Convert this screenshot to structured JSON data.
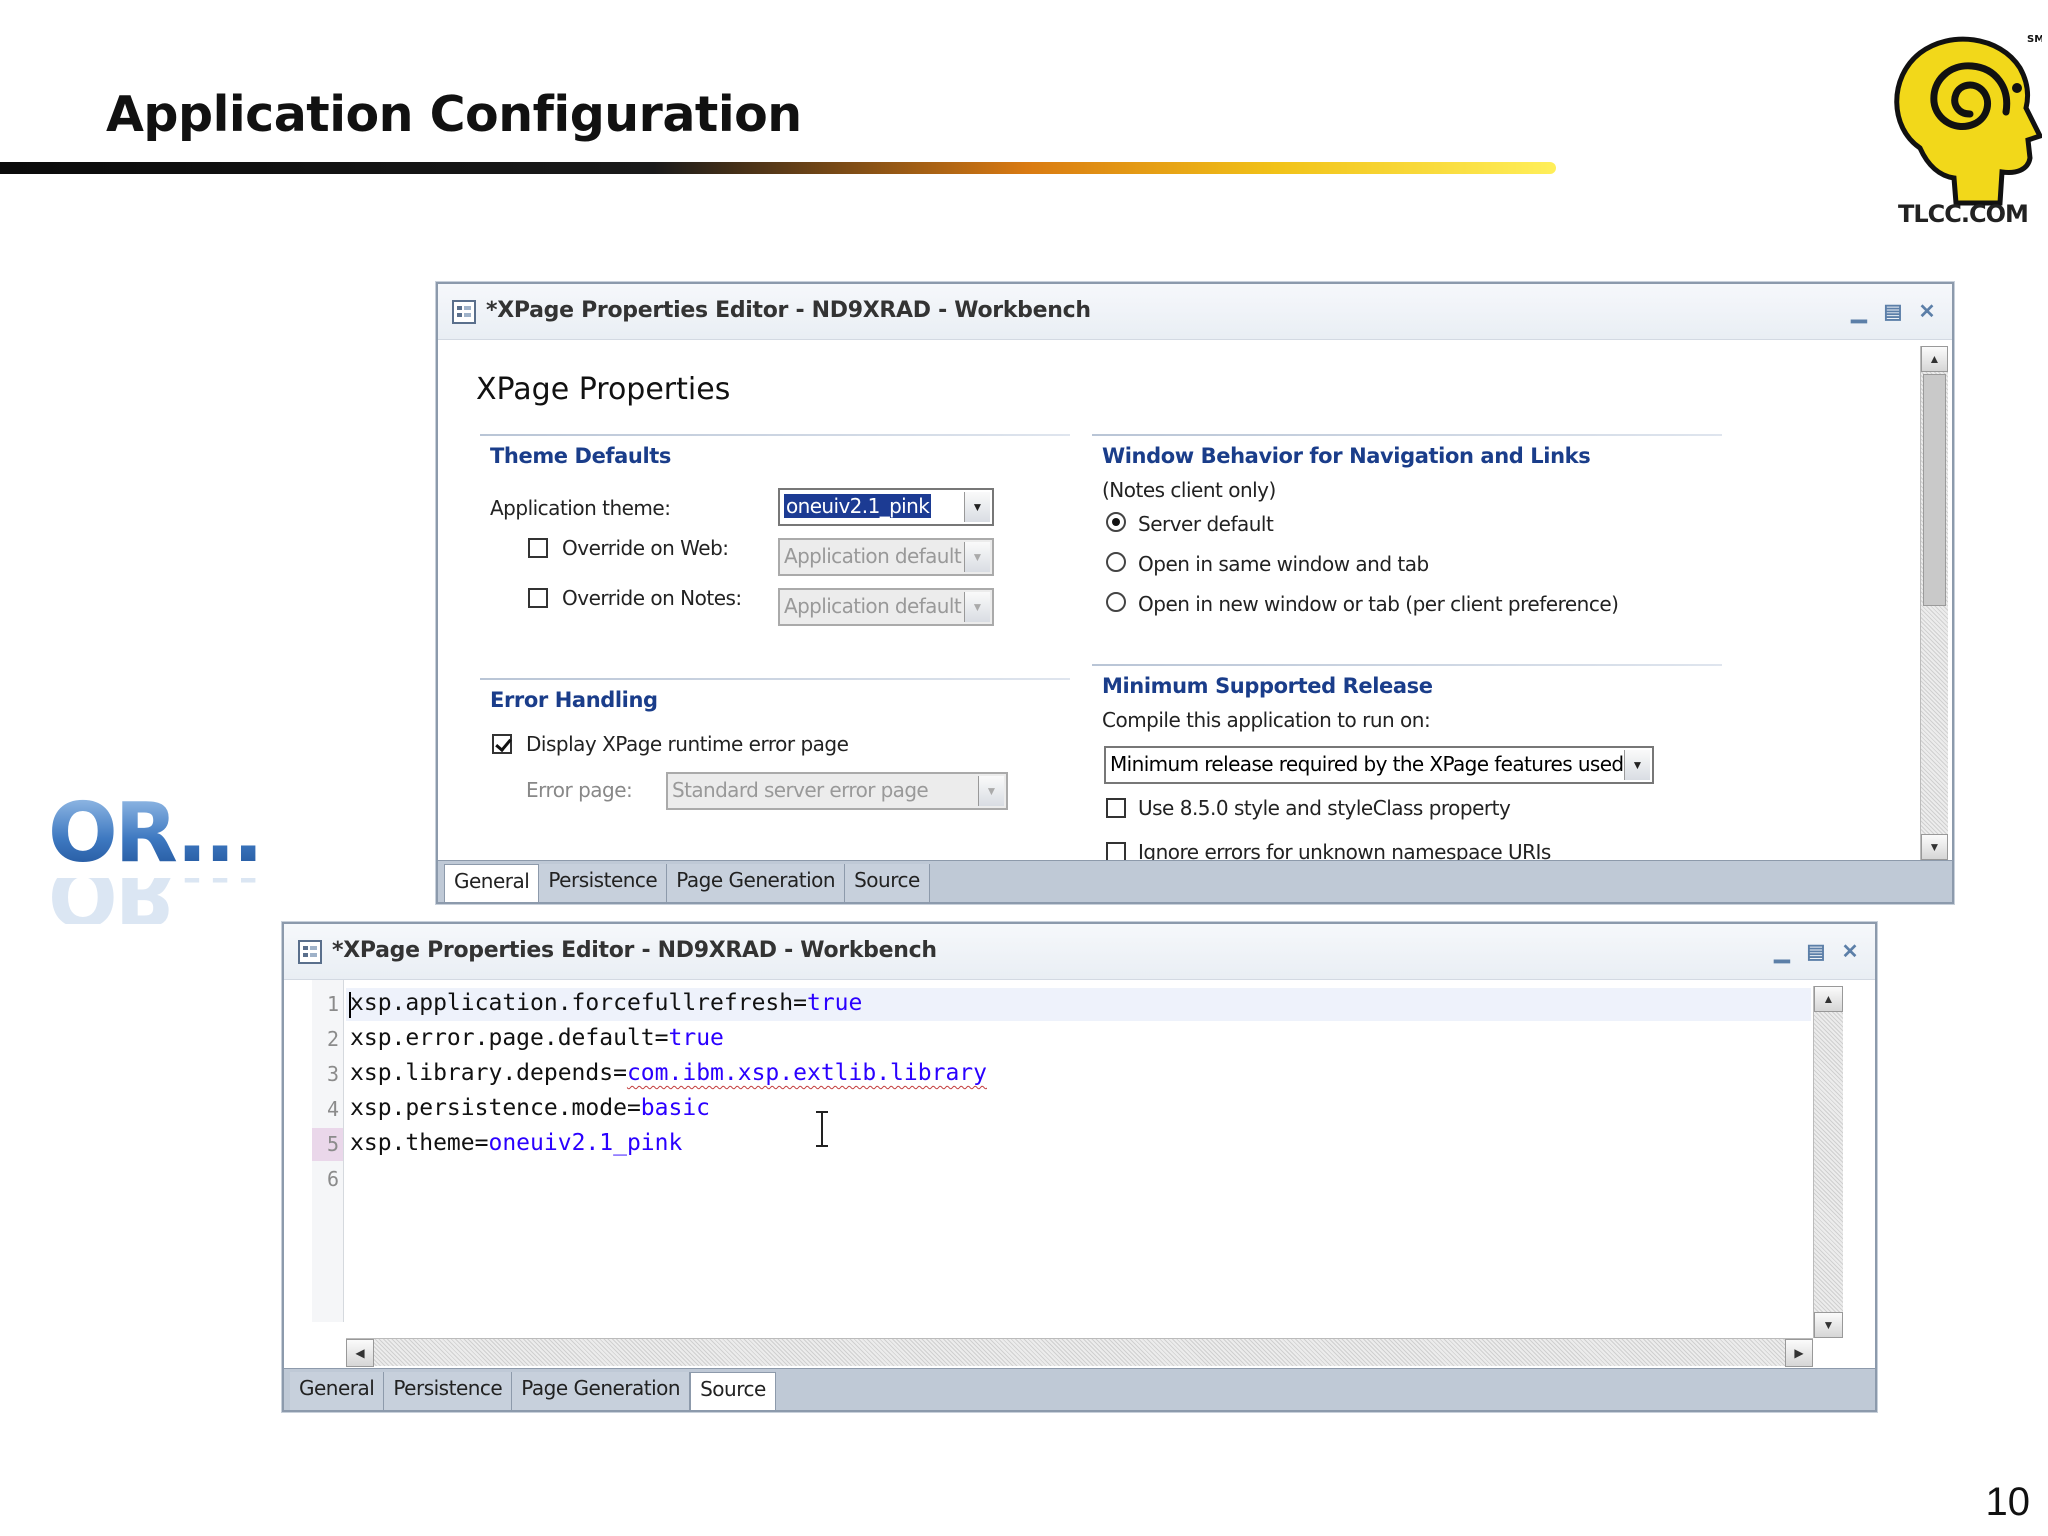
{
  "slide": {
    "title": "Application Configuration",
    "logo_text": "TLCC.COM",
    "logo_sm": "SM",
    "or_text": "OR...",
    "page_number": "10"
  },
  "window_top": {
    "title": "*XPage Properties Editor - ND9XRAD - Workbench",
    "form_title": "XPage Properties",
    "theme_defaults": {
      "heading": "Theme Defaults",
      "app_theme_label": "Application theme:",
      "app_theme_value": "oneuiv2.1_pink",
      "override_web_label": "Override on Web:",
      "override_web_value": "Application default",
      "override_notes_label": "Override on Notes:",
      "override_notes_value": "Application default"
    },
    "error_handling": {
      "heading": "Error Handling",
      "display_error_label": "Display XPage runtime error page",
      "error_page_label": "Error page:",
      "error_page_value": "Standard server error page"
    },
    "window_behavior": {
      "heading": "Window Behavior for Navigation and Links",
      "subtitle": "(Notes client only)",
      "options": [
        "Server default",
        "Open in same window and tab",
        "Open in new window or tab (per client preference)"
      ]
    },
    "min_release": {
      "heading": "Minimum Supported Release",
      "compile_label": "Compile this application to run on:",
      "compile_value": "Minimum release required by the XPage features used",
      "style_label": "Use 8.5.0 style and styleClass property",
      "ignore_label": "Ignore errors for unknown namespace URIs"
    },
    "tabs": [
      "General",
      "Persistence",
      "Page Generation",
      "Source"
    ],
    "active_tab": "General"
  },
  "window_bottom": {
    "title": "*XPage Properties Editor - ND9XRAD - Workbench",
    "lines": [
      {
        "n": "1",
        "key": "xsp.application.forcefullrefresh=",
        "val": "true"
      },
      {
        "n": "2",
        "key": "xsp.error.page.default=",
        "val": "true"
      },
      {
        "n": "3",
        "key": "xsp.library.depends=",
        "val": "com.ibm.xsp.extlib.library"
      },
      {
        "n": "4",
        "key": "xsp.persistence.mode=",
        "val": "basic"
      },
      {
        "n": "5",
        "key": "xsp.theme=",
        "val": "oneuiv2.1_pink"
      },
      {
        "n": "6",
        "key": "",
        "val": ""
      }
    ],
    "tabs": [
      "General",
      "Persistence",
      "Page Generation",
      "Source"
    ],
    "active_tab": "Source"
  },
  "colors": {
    "section_heading": "#1a3d8a",
    "code_value": "#2a00ff",
    "selection": "#1c3b93"
  }
}
